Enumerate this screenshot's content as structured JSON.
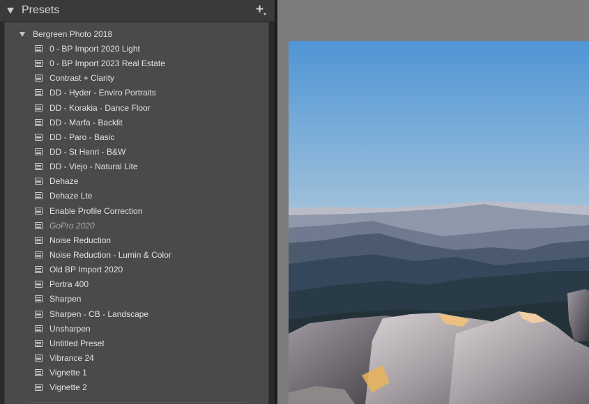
{
  "panel": {
    "title": "Presets",
    "add_glyph": "+",
    "group": {
      "label": "Bergreen Photo 2018"
    },
    "presets": [
      {
        "label": "0 - BP Import 2020 Light"
      },
      {
        "label": "0 - BP Import 2023 Real Estate"
      },
      {
        "label": "Contrast + Clarity"
      },
      {
        "label": "DD - Hyder - Enviro Portraits"
      },
      {
        "label": "DD - Korakia - Dance Floor"
      },
      {
        "label": "DD - Marfa - Backlit"
      },
      {
        "label": "DD - Paro - Basic"
      },
      {
        "label": "DD - St Henri - B&W"
      },
      {
        "label": "DD - Viejo - Natural Lite"
      },
      {
        "label": "Dehaze"
      },
      {
        "label": "Dehaze Lte"
      },
      {
        "label": "Enable Profile Correction"
      },
      {
        "label": "GoPro 2020"
      },
      {
        "label": "Noise Reduction"
      },
      {
        "label": "Noise Reduction - Lumin & Color"
      },
      {
        "label": "Old BP Import 2020"
      },
      {
        "label": "Portra 400"
      },
      {
        "label": "Sharpen"
      },
      {
        "label": "Sharpen - CB - Landscape"
      },
      {
        "label": "Unsharpen"
      },
      {
        "label": "Untitled Preset"
      },
      {
        "label": "Vibrance 24"
      },
      {
        "label": "Vignette 1"
      },
      {
        "label": "Vignette 2"
      }
    ]
  },
  "icons": {
    "collapse": "triangle-down-icon",
    "add": "plus-icon",
    "preset": "preset-list-icon"
  },
  "colors": {
    "panel_bg": "#2b2b2b",
    "list_bg": "#4a4a4a",
    "text": "#e2e2e2",
    "canvas_bg": "#7d7d7d"
  }
}
